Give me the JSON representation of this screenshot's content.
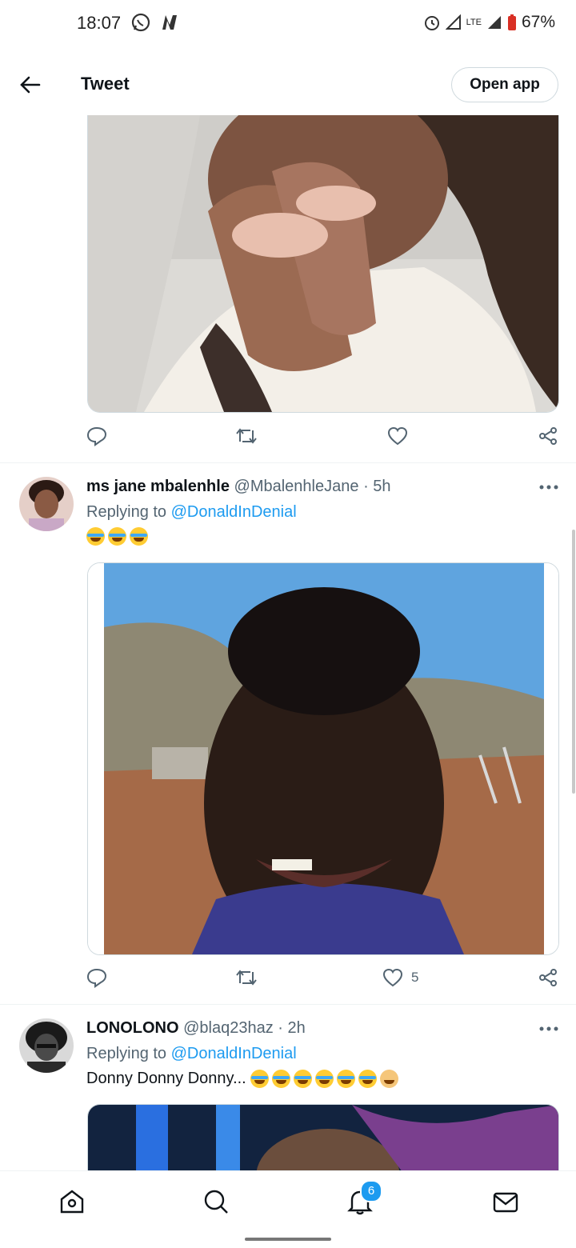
{
  "status_bar": {
    "time": "18:07",
    "network": "LTE",
    "battery": "67%"
  },
  "header": {
    "title": "Tweet",
    "open_app_label": "Open app"
  },
  "tweets": [
    {
      "name": "ms jane mbalenhle",
      "handle": "@MbalenhleJane",
      "time": "· 5h",
      "replying_label": "Replying to",
      "replying_to": "@DonaldInDenial",
      "likes": "5"
    },
    {
      "name": "LONOLONO",
      "handle": "@blaq23haz",
      "time": "· 2h",
      "replying_label": "Replying to",
      "replying_to": "@DonaldInDenial",
      "text": "Donny Donny Donny..."
    }
  ],
  "bottom_nav": {
    "notifications_count": "6"
  },
  "colors": {
    "accent": "#1d9bf0",
    "text": "#0f1419",
    "muted": "#536471"
  }
}
